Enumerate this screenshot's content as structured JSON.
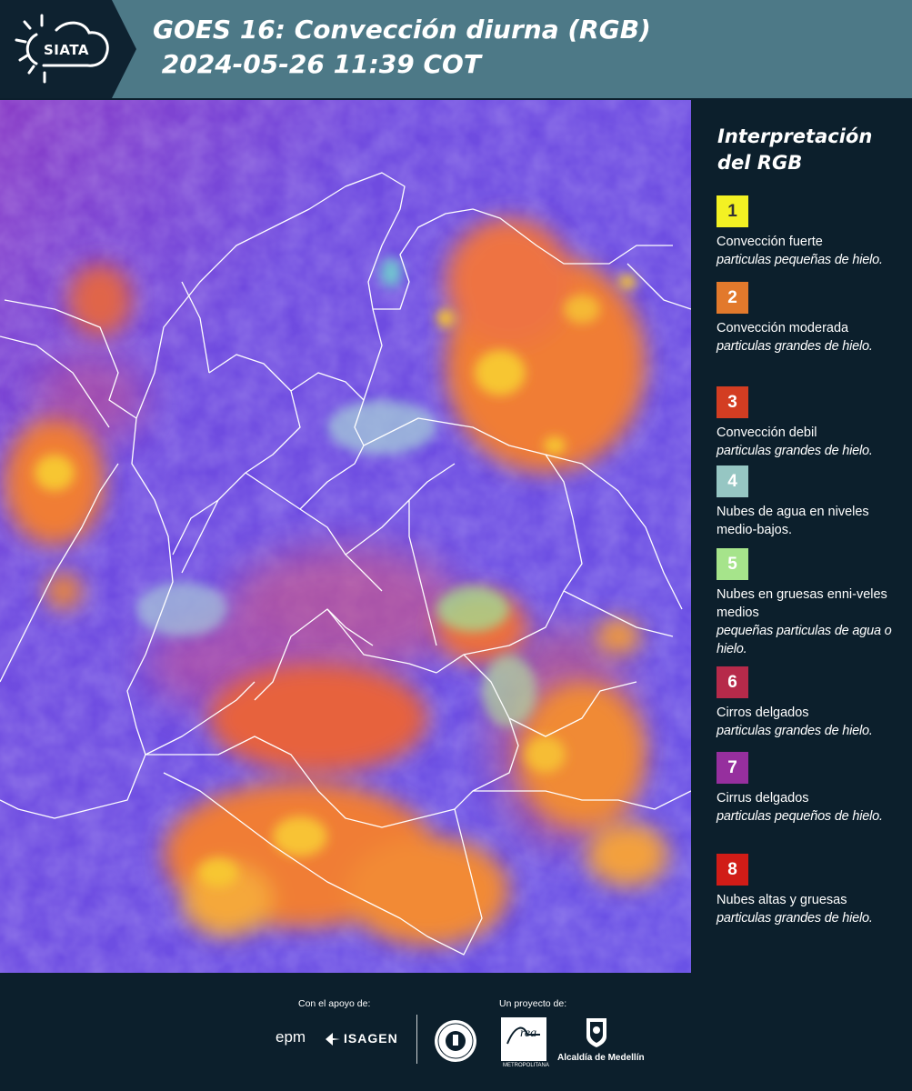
{
  "header": {
    "logo_text": "SIATA",
    "title_line1": "GOES 16: Convección diurna (RGB)",
    "title_line2": " 2024-05-26 11:39 COT"
  },
  "map": {
    "base_color": "#6d48e2",
    "boundary_color": "#ffffff",
    "cloud_colors": [
      "#f07d34",
      "#f7c633",
      "#e05532",
      "#9be89a",
      "#a7d3d8"
    ]
  },
  "legend": {
    "title": "Interpretación del RGB",
    "items": [
      {
        "num": "1",
        "color": "#f3f123",
        "num_color": "#333333",
        "label": "Convección fuerte",
        "sub": "particulas pequeñas de hielo."
      },
      {
        "num": "2",
        "color": "#e2792c",
        "num_color": "#ffffff",
        "label": "Convección moderada",
        "sub": "particulas grandes de hielo."
      },
      {
        "num": "3",
        "color": "#d33d22",
        "num_color": "#ffffff",
        "label": "Convección debil",
        "sub": "particulas grandes de hielo."
      },
      {
        "num": "4",
        "color": "#96c6c3",
        "num_color": "#ffffff",
        "label": "Nubes de agua en niveles medio-bajos.",
        "sub": ""
      },
      {
        "num": "5",
        "color": "#a6e48b",
        "num_color": "#ffffff",
        "label": "Nubes en gruesas enni-veles medios",
        "sub": "pequeñas particulas de agua o hielo."
      },
      {
        "num": "6",
        "color": "#b62a4a",
        "num_color": "#ffffff",
        "label": "Cirros delgados",
        "sub": "particulas grandes de hielo."
      },
      {
        "num": "7",
        "color": "#962f9e",
        "num_color": "#ffffff",
        "label": "Cirrus delgados",
        "sub": "particulas pequeños de hielo."
      },
      {
        "num": "8",
        "color": "#d11c17",
        "num_color": "#ffffff",
        "label": "Nubes altas y gruesas",
        "sub": "particulas grandes de hielo."
      }
    ]
  },
  "footer": {
    "support_label": "Con el apoyo de:",
    "project_label": "Un proyecto de:",
    "epm": "epm",
    "isagen": "ISAGEN",
    "metropolitana": "METROPOLITANA",
    "area_sub": "Valle de Aburrá",
    "alcaldia": "Alcaldía de Medellín"
  }
}
